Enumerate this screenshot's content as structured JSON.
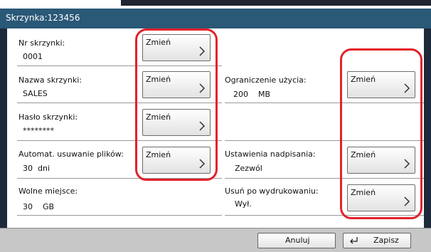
{
  "window": {
    "title": "Skrzynka:123456"
  },
  "fields": {
    "box_number": {
      "label": "Nr skrzynki:",
      "value": "0001",
      "button": "Zmień"
    },
    "box_name": {
      "label": "Nazwa skrzynki:",
      "value": "SALES",
      "button": "Zmień"
    },
    "box_password": {
      "label": "Hasło skrzynki:",
      "value": "********",
      "button": "Zmień"
    },
    "auto_delete": {
      "label": "Automat. usuwanie plików:",
      "value": "30",
      "unit": "dni",
      "button": "Zmień"
    },
    "free_space": {
      "label": "Wolne miejsce:",
      "value": "30",
      "unit": "GB"
    },
    "usage_limit": {
      "label": "Ograniczenie użycia:",
      "value": "200",
      "unit": "MB",
      "button": "Zmień"
    },
    "overwrite": {
      "label": "Ustawienia nadpisania:",
      "value": "Zezwól",
      "button": "Zmień"
    },
    "delete_after_print": {
      "label": "Usuń po wydrukowaniu:",
      "value": "Wył.",
      "button": "Zmień"
    }
  },
  "footer": {
    "cancel_label": "Anuluj",
    "save_label": "Zapisz"
  },
  "colors": {
    "title_bar": "#2a5877",
    "frame": "#1c2a3a",
    "highlight": "#e3222a",
    "footer": "#c7c7c7"
  },
  "icons": [
    "chevron-right-icon",
    "enter-icon"
  ]
}
